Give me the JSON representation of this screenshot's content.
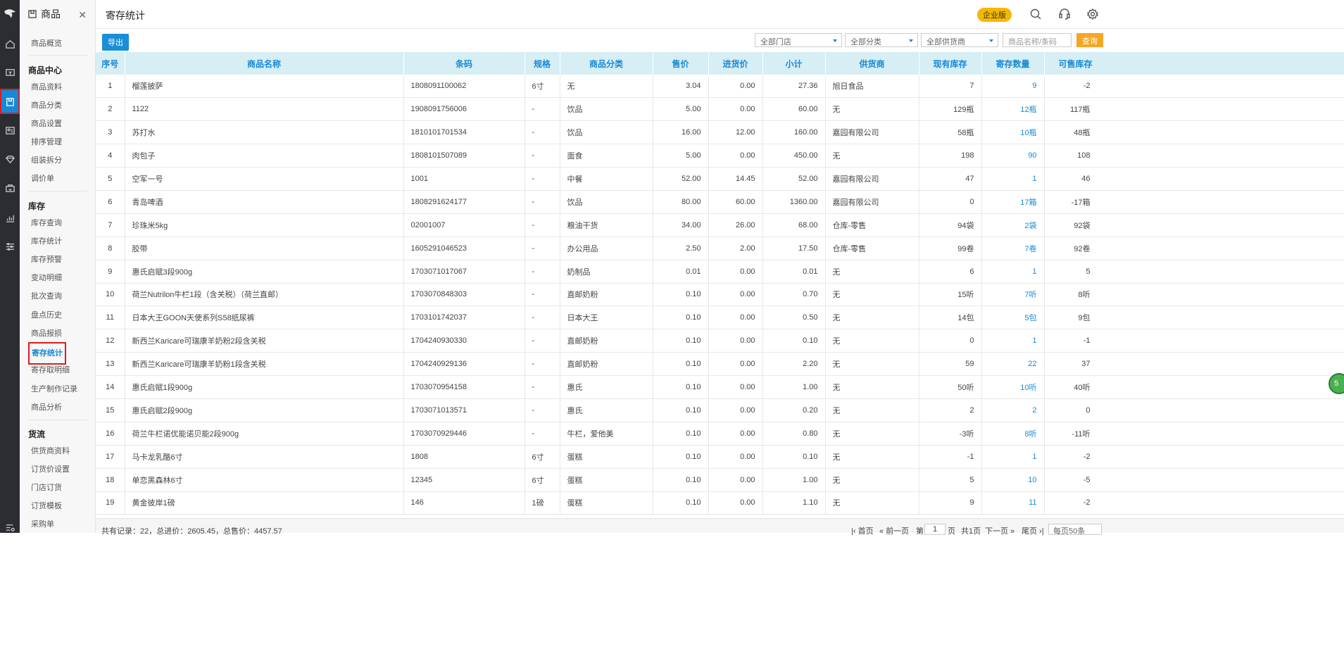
{
  "sidebar": {
    "title": "商品",
    "items_top": [
      {
        "label": "商品概览"
      }
    ],
    "groups": [
      {
        "title": "商品中心",
        "items": [
          "商品资料",
          "商品分类",
          "商品设置",
          "排序管理",
          "组装拆分",
          "调价单"
        ]
      },
      {
        "title": "库存",
        "items": [
          "库存查询",
          "库存统计",
          "库存预警",
          "变动明细",
          "批次查询",
          "盘点历史",
          "商品报损",
          "寄存统计",
          "寄存取明细",
          "生产制作记录",
          "商品分析"
        ]
      },
      {
        "title": "货流",
        "items": [
          "供货商资料",
          "订货价设置",
          "门店订货",
          "订货模板",
          "采购单"
        ]
      }
    ]
  },
  "header": {
    "title": "寄存统计",
    "edition_badge": "企业版"
  },
  "toolbar": {
    "export_label": "导出",
    "store_select": "全部门店",
    "category_select": "全部分类",
    "supplier_select": "全部供货商",
    "search_placeholder": "商品名称/条码",
    "query_label": "查询"
  },
  "table": {
    "columns": [
      "序号",
      "商品名称",
      "条码",
      "规格",
      "商品分类",
      "售价",
      "进货价",
      "小计",
      "供货商",
      "现有库存",
      "寄存数量",
      "可售库存"
    ],
    "rows": [
      [
        "1",
        "榴莲披萨",
        "1808091100062",
        "6寸",
        "无",
        "3.04",
        "0.00",
        "27.36",
        "旭日食品",
        "7",
        "9",
        "-2"
      ],
      [
        "2",
        "1122",
        "1908091756006",
        "-",
        "饮品",
        "5.00",
        "0.00",
        "60.00",
        "无",
        "129瓶",
        "12瓶",
        "117瓶"
      ],
      [
        "3",
        "苏打水",
        "1810101701534",
        "-",
        "饮品",
        "16.00",
        "12.00",
        "160.00",
        "嘉园有限公司",
        "58瓶",
        "10瓶",
        "48瓶"
      ],
      [
        "4",
        "肉包子",
        "1808101507089",
        "-",
        "面食",
        "5.00",
        "0.00",
        "450.00",
        "无",
        "198",
        "90",
        "108"
      ],
      [
        "5",
        "空军一号",
        "1001",
        "-",
        "中餐",
        "52.00",
        "14.45",
        "52.00",
        "嘉园有限公司",
        "47",
        "1",
        "46"
      ],
      [
        "6",
        "青岛啤酒",
        "1808291624177",
        "-",
        "饮品",
        "80.00",
        "60.00",
        "1360.00",
        "嘉园有限公司",
        "0",
        "17箱",
        "-17箱"
      ],
      [
        "7",
        "珍珠米5kg",
        "02001007",
        "-",
        "粮油干货",
        "34.00",
        "26.00",
        "68.00",
        "仓库-零售",
        "94袋",
        "2袋",
        "92袋"
      ],
      [
        "8",
        "胶带",
        "1605291046523",
        "-",
        "办公用品",
        "2.50",
        "2.00",
        "17.50",
        "仓库-零售",
        "99卷",
        "7卷",
        "92卷"
      ],
      [
        "9",
        "惠氏启赋3段900g",
        "1703071017067",
        "-",
        "奶制品",
        "0.01",
        "0.00",
        "0.01",
        "无",
        "6",
        "1",
        "5"
      ],
      [
        "10",
        "荷兰Nutrilon牛栏1段（含关税）（荷兰直邮）",
        "1703070848303",
        "-",
        "直邮奶粉",
        "0.10",
        "0.00",
        "0.70",
        "无",
        "15听",
        "7听",
        "8听"
      ],
      [
        "11",
        "日本大王GOON天使系列S58纸尿裤",
        "1703101742037",
        "-",
        "日本大王",
        "0.10",
        "0.00",
        "0.50",
        "无",
        "14包",
        "5包",
        "9包"
      ],
      [
        "12",
        "新西兰Karicare可瑞康羊奶粉2段含关税",
        "1704240930330",
        "-",
        "直邮奶粉",
        "0.10",
        "0.00",
        "0.10",
        "无",
        "0",
        "1",
        "-1"
      ],
      [
        "13",
        "新西兰Karicare可瑞康羊奶粉1段含关税",
        "1704240929136",
        "-",
        "直邮奶粉",
        "0.10",
        "0.00",
        "2.20",
        "无",
        "59",
        "22",
        "37"
      ],
      [
        "14",
        "惠氏启赋1段900g",
        "1703070954158",
        "-",
        "惠氏",
        "0.10",
        "0.00",
        "1.00",
        "无",
        "50听",
        "10听",
        "40听"
      ],
      [
        "15",
        "惠氏启赋2段900g",
        "1703071013571",
        "-",
        "惠氏",
        "0.10",
        "0.00",
        "0.20",
        "无",
        "2",
        "2",
        "0"
      ],
      [
        "16",
        "荷兰牛栏诺优能诺贝能2段900g",
        "1703070929446",
        "-",
        "牛栏，爱他美",
        "0.10",
        "0.00",
        "0.80",
        "无",
        "-3听",
        "8听",
        "-11听"
      ],
      [
        "17",
        "马卡龙乳酪6寸",
        "1808",
        "6寸",
        "蛋糕",
        "0.10",
        "0.00",
        "0.10",
        "无",
        "-1",
        "1",
        "-2"
      ],
      [
        "18",
        "单恋黑森林6寸",
        "12345",
        "6寸",
        "蛋糕",
        "0.10",
        "0.00",
        "1.00",
        "无",
        "5",
        "10",
        "-5"
      ],
      [
        "19",
        "黄金彼岸1磅",
        "146",
        "1磅",
        "蛋糕",
        "0.10",
        "0.00",
        "1.10",
        "无",
        "9",
        "11",
        "-2"
      ]
    ]
  },
  "footer": {
    "summary": "共有记录：22，总进价：2605.45，总售价：4457.57",
    "first": "首页",
    "prev": "前一页",
    "page_prefix": "第",
    "page_value": "1",
    "page_suffix": "页",
    "total_pages": "共1页",
    "next": "下一页",
    "last": "尾页",
    "page_size": "每页50条"
  },
  "float_badge": "5"
}
